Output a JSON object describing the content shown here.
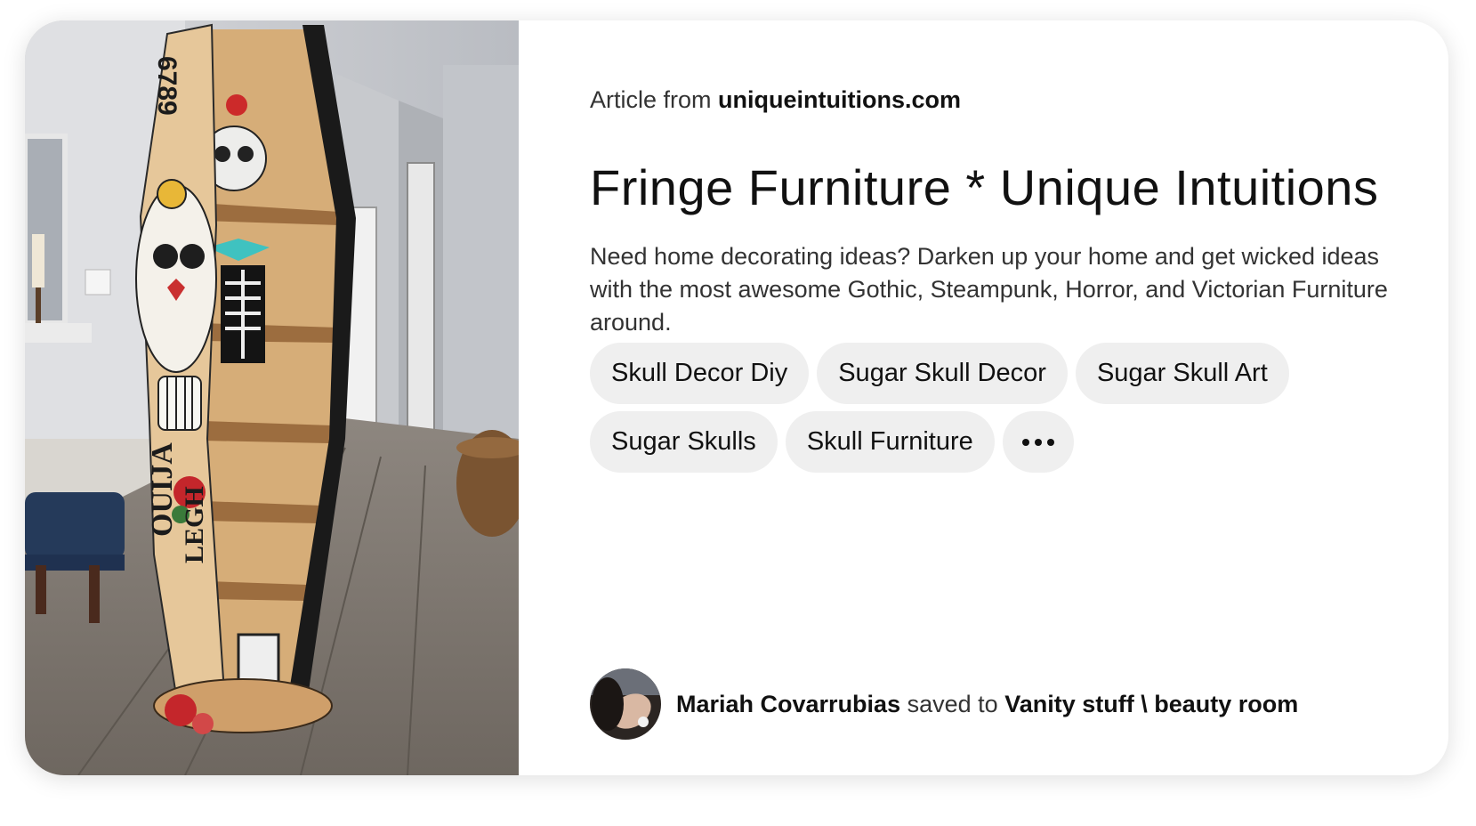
{
  "article": {
    "prefix": "Article from",
    "domain": "uniqueintuitions.com"
  },
  "pin": {
    "title": "Fringe Furniture * Unique Intuitions",
    "description": "Need home decorating ideas? Darken up your home and get wicked ideas with the most awesome Gothic, Steampunk, Horror, and Victorian Furniture around.",
    "image_icon": "coffin-shelf-photo"
  },
  "tags": {
    "row1": [
      "Skull Decor Diy",
      "Sugar Skull Decor",
      "Sugar Skull Art"
    ],
    "row2": [
      "Sugar Skulls",
      "Skull Furniture"
    ],
    "more_icon": "ellipsis-icon"
  },
  "saved_by": {
    "user": "Mariah Covarrubias",
    "verb": "saved to",
    "board": "Vanity stuff \\ beauty room",
    "avatar_icon": "user-avatar"
  },
  "colors": {
    "tag_background": "#efefef",
    "text_primary": "#111111",
    "text_secondary": "#333333"
  }
}
